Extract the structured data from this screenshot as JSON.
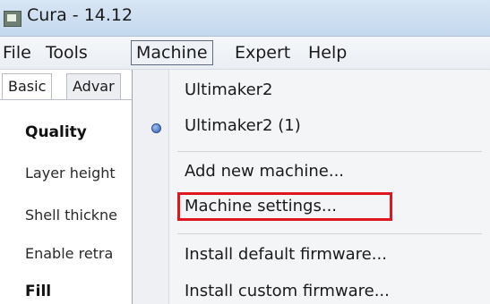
{
  "window": {
    "title": "Cura - 14.12"
  },
  "menubar": {
    "items": [
      "File",
      "Tools",
      "Machine",
      "Expert",
      "Help"
    ],
    "active": "Machine"
  },
  "left_panel": {
    "tabs": [
      "Basic",
      "Advar"
    ],
    "rows": [
      {
        "label": "Quality",
        "is_header": true
      },
      {
        "label": "Layer height",
        "is_header": false
      },
      {
        "label": "Shell thickne",
        "is_header": false
      },
      {
        "label": "Enable retra",
        "is_header": false
      },
      {
        "label": "Fill",
        "is_header": true
      }
    ]
  },
  "machine_menu": {
    "items": [
      {
        "label": "Ultimaker2",
        "checked": false
      },
      {
        "label": "Ultimaker2 (1)",
        "checked": true
      },
      {
        "label": "Add new machine...",
        "checked": false
      },
      {
        "label": "Machine settings...",
        "checked": false,
        "highlighted": true
      },
      {
        "label": "Install default firmware...",
        "checked": false
      },
      {
        "label": "Install custom firmware...",
        "checked": false
      }
    ]
  },
  "colors": {
    "highlight_box": "#e0161f",
    "radio": "#2f5fb8"
  },
  "icons": {
    "app": "cura-app-icon",
    "radio": "radio-selected-icon"
  }
}
